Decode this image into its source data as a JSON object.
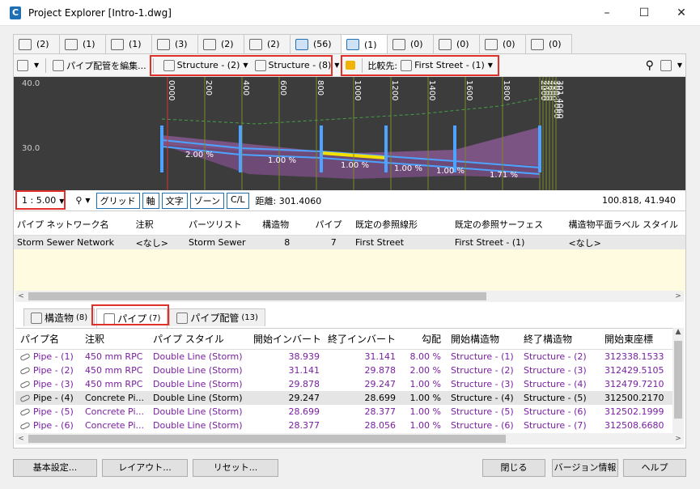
{
  "window": {
    "title": "Project Explorer [Intro-1.dwg]",
    "app_icon": "C"
  },
  "icon_tabs": [
    {
      "icon": "alignment-icon",
      "count": "(2)"
    },
    {
      "icon": "site-icon",
      "count": "(1)"
    },
    {
      "icon": "corridor-icon",
      "count": "(1)"
    },
    {
      "icon": "surface-icon",
      "count": "(3)"
    },
    {
      "icon": "parcel-icon",
      "count": "(2)"
    },
    {
      "icon": "feature-line-icon",
      "count": "(2)"
    },
    {
      "icon": "pipe-network-icon",
      "count": "(56)"
    },
    {
      "icon": "pipe-network-icon",
      "count": "(1)"
    },
    {
      "icon": "pressure-network-icon",
      "count": "(0)"
    },
    {
      "icon": "sample-line-icon",
      "count": "(0)"
    },
    {
      "icon": "point-group-icon",
      "count": "(0)"
    },
    {
      "icon": "data-shortcut-icon",
      "count": "(0)"
    }
  ],
  "profile_toolbar": {
    "edit_pipe_label": "パイプ配管を編集...",
    "struct_from": "Structure - (2)",
    "struct_to": "Structure - (8)",
    "compare_label": "比較先:",
    "compare_value": "First Street - (1)"
  },
  "profile": {
    "y_labels": [
      "40.0",
      "30.0"
    ],
    "stations": [
      "0000",
      "200",
      "400",
      "600",
      "800",
      "1000",
      "1200",
      "1400",
      "1600",
      "1800",
      "2000",
      "2200",
      "2400",
      "2600",
      "2800",
      "300.4060",
      "301.4060"
    ],
    "slopes": [
      "2.00 %",
      "1.00 %",
      "1.00 %",
      "1.00 %",
      "1.00 %",
      "1.71 %"
    ]
  },
  "profile_status": {
    "scale": "1 : 5.00",
    "buttons": [
      "グリッド",
      "軸",
      "文字",
      "ゾーン",
      "C/L"
    ],
    "distance": "距離: 301.4060",
    "coords": "100.818, 41.940"
  },
  "network_grid": {
    "headers": [
      "パイプ ネットワーク名",
      "注釈",
      "パーツリスト",
      "構造物",
      "パイプ",
      "既定の参照線形",
      "既定の参照サーフェス",
      "構造物平面ラベル スタイル"
    ],
    "rows": [
      [
        "Storm Sewer Network",
        "<なし>",
        "Storm Sewer",
        "8",
        "7",
        "First Street",
        "First Street - (1)",
        "<なし>"
      ]
    ]
  },
  "bottom_tabs": [
    {
      "label": "構造物",
      "count": "(8)"
    },
    {
      "label": "パイプ",
      "count": "(7)"
    },
    {
      "label": "パイプ配管",
      "count": "(13)"
    }
  ],
  "pipe_grid": {
    "headers": [
      "パイプ名",
      "注釈",
      "パイプ スタイル",
      "開始インバート",
      "終了インバート",
      "勾配",
      "開始構造物",
      "終了構造物",
      "開始東座標"
    ],
    "rows": [
      [
        "Pipe - (1)",
        "450 mm RPC",
        "Double Line (Storm)",
        "38.939",
        "31.141",
        "8.00 %",
        "Structure - (1)",
        "Structure - (2)",
        "312338.1533"
      ],
      [
        "Pipe - (2)",
        "450 mm RPC",
        "Double Line (Storm)",
        "31.141",
        "29.878",
        "2.00 %",
        "Structure - (2)",
        "Structure - (3)",
        "312429.5105"
      ],
      [
        "Pipe - (3)",
        "450 mm RPC",
        "Double Line (Storm)",
        "29.878",
        "29.247",
        "1.00 %",
        "Structure - (3)",
        "Structure - (4)",
        "312479.7210"
      ],
      [
        "Pipe - (4)",
        "Concrete Pi...",
        "Double Line (Storm)",
        "29.247",
        "28.699",
        "1.00 %",
        "Structure - (4)",
        "Structure - (5)",
        "312500.2170"
      ],
      [
        "Pipe - (5)",
        "Concrete Pi...",
        "Double Line (Storm)",
        "28.699",
        "28.377",
        "1.00 %",
        "Structure - (5)",
        "Structure - (6)",
        "312502.1999"
      ],
      [
        "Pipe - (6)",
        "Concrete Pi...",
        "Double Line (Storm)",
        "28.377",
        "28.056",
        "1.00 %",
        "Structure - (6)",
        "Structure - (7)",
        "312508.6680"
      ]
    ]
  },
  "footer": {
    "settings": "基本設定...",
    "layout": "レイアウト...",
    "reset": "リセット...",
    "close": "閉じる",
    "version": "バージョン情報",
    "help": "ヘルプ"
  },
  "colors": {
    "accent": "#1f6fb5",
    "highlight_red": "#e0302a",
    "purple_text": "#7a1fa2"
  }
}
